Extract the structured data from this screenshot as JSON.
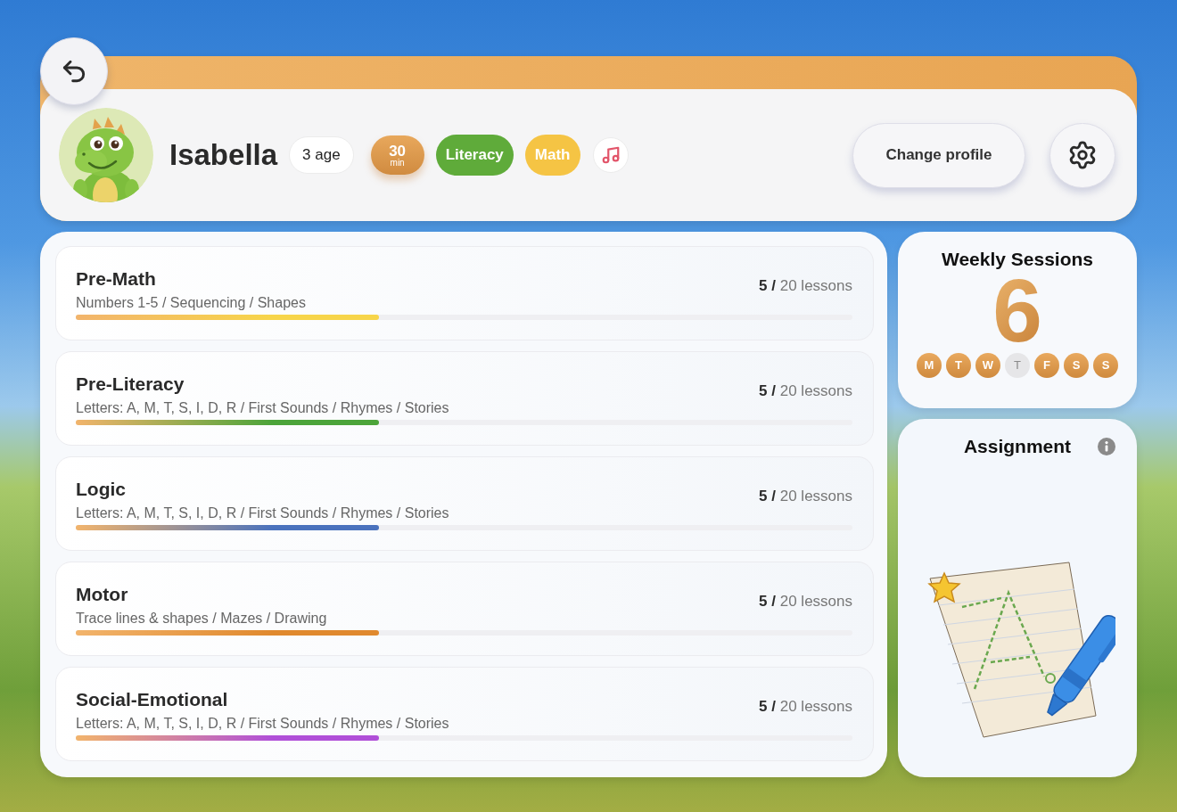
{
  "profile": {
    "name": "Isabella",
    "age": "3 age",
    "session_length": {
      "value": "30",
      "unit": "min"
    },
    "tags": [
      {
        "label": "Literacy",
        "color": "#5fab3a"
      },
      {
        "label": "Math",
        "color": "#f5c444"
      }
    ],
    "change_profile": "Change profile"
  },
  "subjects": [
    {
      "title": "Pre-Math",
      "topics": "Numbers 1-5 / Sequencing / Shapes",
      "count": "**5 /** 20 lessons",
      "level": 0.39,
      "color": "#f7d54a"
    },
    {
      "title": "Pre-Literacy",
      "topics": "Letters: A, M, T, S, I, D, R / First Sounds / Rhymes / Stories",
      "count": "**5 /** 20 lessons",
      "level": 0.39,
      "color": "#4ca43a"
    },
    {
      "title": "Logic",
      "topics": "Letters: A, M, T, S, I, D, R / First Sounds / Rhymes / Stories",
      "count": "**5 /** 20 lessons",
      "level": 0.39,
      "color": "#4a72bd"
    },
    {
      "title": "Motor",
      "topics": "Trace lines & shapes / Mazes / Drawing",
      "count": "**5 /** 20 lessons",
      "level": 0.39,
      "color": "#e0892e"
    },
    {
      "title": "Social-Emotional",
      "topics": "Letters: A, M, T, S, I, D, R / First Sounds / Rhymes / Stories",
      "count": "**5 /** 20 lessons",
      "level": 0.39,
      "color": "#b04fd8"
    }
  ],
  "weekly_sessions": {
    "title": "Weekly Sessions",
    "count": "6",
    "days": [
      {
        "label": "M",
        "done": true
      },
      {
        "label": "T",
        "done": true
      },
      {
        "label": "W",
        "done": true
      },
      {
        "label": "T",
        "done": false
      },
      {
        "label": "F",
        "done": true
      },
      {
        "label": "S",
        "done": true
      },
      {
        "label": "S",
        "done": true
      }
    ]
  },
  "assignment": {
    "title": "Assignment"
  }
}
